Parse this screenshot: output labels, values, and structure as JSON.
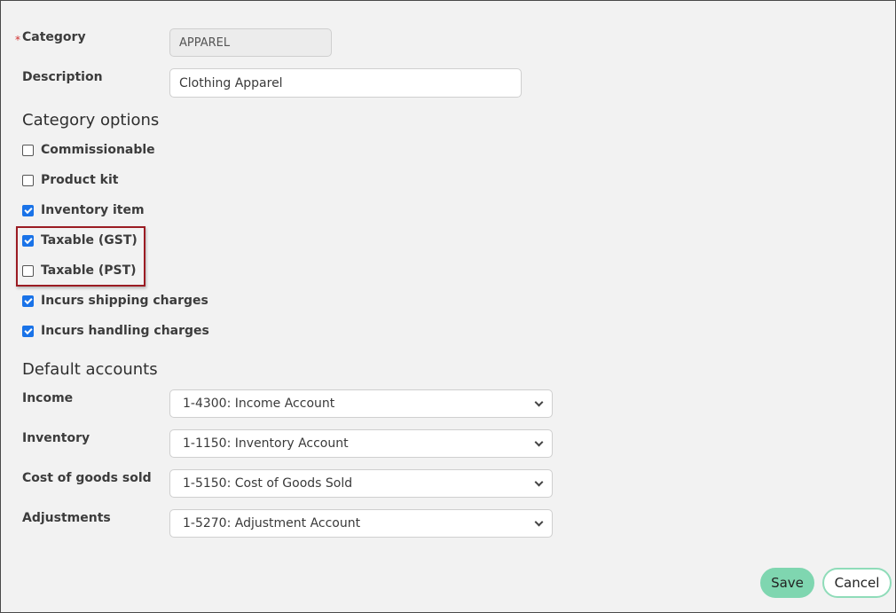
{
  "form": {
    "category": {
      "label": "Category",
      "required_marker": "*",
      "value": "APPAREL"
    },
    "description": {
      "label": "Description",
      "value": "Clothing Apparel"
    }
  },
  "category_options": {
    "title": "Category options",
    "items": [
      {
        "label": "Commissionable",
        "checked": false
      },
      {
        "label": "Product kit",
        "checked": false
      },
      {
        "label": "Inventory item",
        "checked": true
      },
      {
        "label": "Taxable (GST)",
        "checked": true
      },
      {
        "label": "Taxable (PST)",
        "checked": false
      },
      {
        "label": "Incurs shipping charges",
        "checked": true
      },
      {
        "label": "Incurs handling charges",
        "checked": true
      }
    ]
  },
  "default_accounts": {
    "title": "Default accounts",
    "rows": [
      {
        "label": "Income",
        "value": "1-4300: Income Account"
      },
      {
        "label": "Inventory",
        "value": "1-1150: Inventory Account"
      },
      {
        "label": "Cost of goods sold",
        "value": "1-5150: Cost of Goods Sold"
      },
      {
        "label": "Adjustments",
        "value": "1-5270: Adjustment Account"
      }
    ]
  },
  "actions": {
    "save": "Save",
    "cancel": "Cancel"
  },
  "colors": {
    "accent": "#7fd6b0",
    "highlight": "#9b1c23",
    "checkbox": "#1a73e8"
  }
}
